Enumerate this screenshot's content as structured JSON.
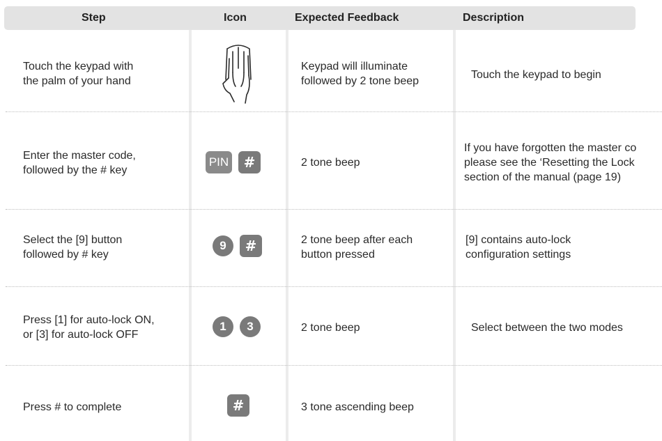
{
  "headers": {
    "step": "Step",
    "icon": "Icon",
    "feedback": "Expected Feedback",
    "description": "Description"
  },
  "rows": [
    {
      "step": [
        "Touch the keypad with",
        "the palm of your hand"
      ],
      "icon": "palm-icon",
      "feedback": [
        "Keypad will illuminate",
        "followed by 2 tone beep"
      ],
      "description": [
        "Touch the keypad to begin"
      ]
    },
    {
      "step": [
        "Enter the master code,",
        "followed by the  #  key"
      ],
      "icon_keys": [
        "PIN",
        "#"
      ],
      "feedback": [
        "2 tone beep"
      ],
      "description": [
        "If you have forgotten the master co",
        "please see the ‘Resetting the Lock",
        "section of the manual (page 19)"
      ]
    },
    {
      "step": [
        "Select the [9] button",
        "followed by  #  key"
      ],
      "icon_keys": [
        "9",
        "#"
      ],
      "feedback": [
        "2 tone beep after each",
        "button pressed"
      ],
      "description": [
        "[9] contains auto-lock",
        "configuration settings"
      ]
    },
    {
      "step": [
        "Press [1] for auto-lock ON,",
        "or [3] for auto-lock OFF"
      ],
      "icon_keys": [
        "1",
        "3"
      ],
      "feedback": [
        "2 tone beep"
      ],
      "description": [
        "Select between the two modes"
      ]
    },
    {
      "step": [
        "Press # to complete"
      ],
      "icon_keys": [
        "#"
      ],
      "feedback": [
        "3 tone ascending beep"
      ],
      "description": []
    }
  ],
  "colors": {
    "header_bg": "#e3e3e3",
    "key_fill": "#7a7a7a",
    "divider": "#ececec"
  }
}
